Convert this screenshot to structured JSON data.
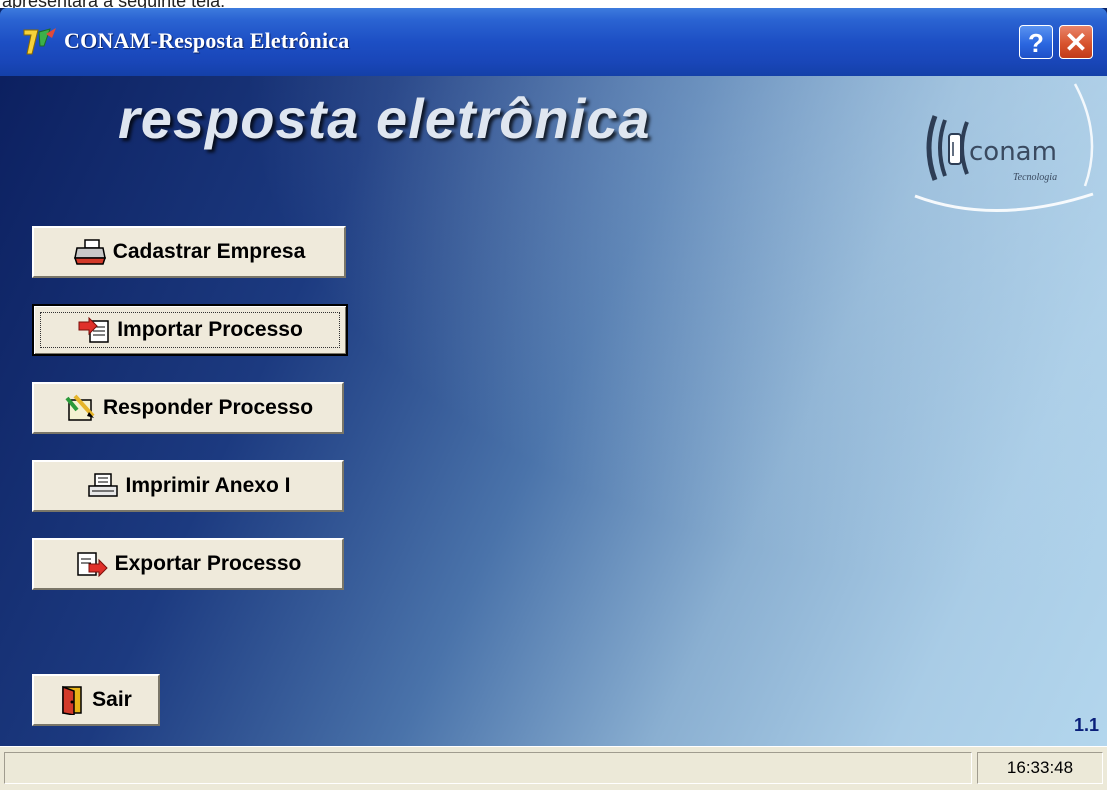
{
  "caption_fragment": "apresentará a seguinte tela:",
  "window": {
    "title": "CONAM-Resposta Eletrônica",
    "help_glyph": "?",
    "close_glyph": "✕"
  },
  "app_title": "resposta eletrônica",
  "logo": {
    "name": "conam",
    "tagline": "Tecnologia"
  },
  "buttons": {
    "cadastrar": {
      "label": "Cadastrar Empresa",
      "icon": "printer-icon"
    },
    "importar": {
      "label": "Importar Processo",
      "icon": "import-document-icon"
    },
    "responder": {
      "label": "Responder Processo",
      "icon": "pen-document-icon"
    },
    "imprimir": {
      "label": "Imprimir Anexo I",
      "icon": "print-icon"
    },
    "exportar": {
      "label": "Exportar Processo",
      "icon": "export-document-icon"
    },
    "sair": {
      "label": "Sair",
      "icon": "exit-door-icon"
    }
  },
  "version": "1.1",
  "status": {
    "time": "16:33:48"
  },
  "colors": {
    "titlebar": "#2a63d2",
    "button_face": "#efeadb",
    "version_text": "#0a1f7a",
    "statusbar": "#ece9d8"
  }
}
